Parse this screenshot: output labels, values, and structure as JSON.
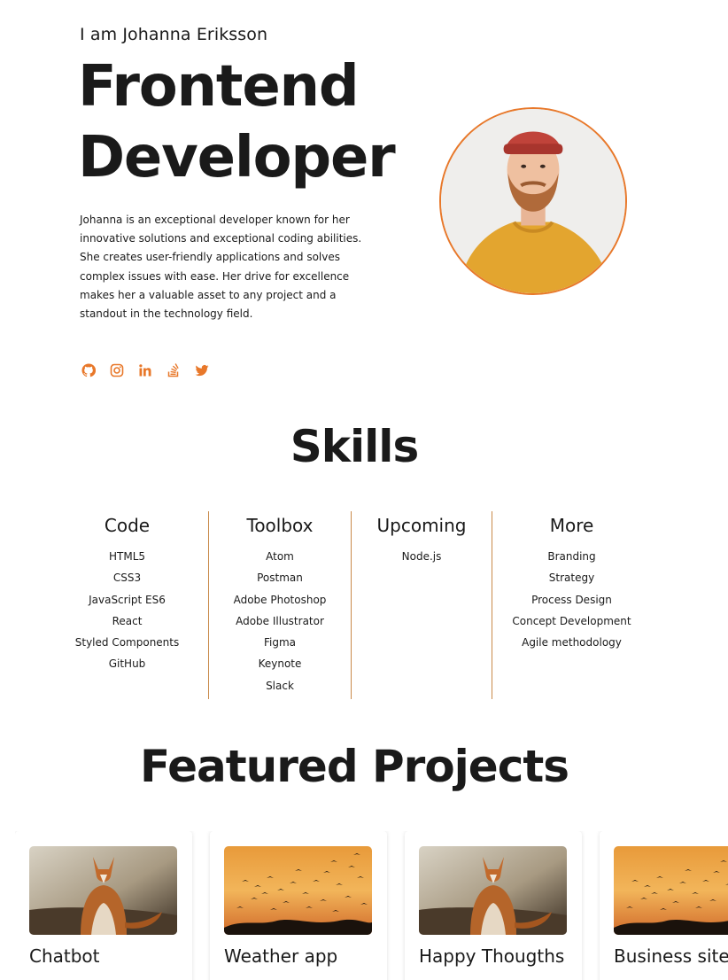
{
  "hero": {
    "intro": "I am Johanna Eriksson",
    "title_line1": "Frontend",
    "title_line2": "Developer",
    "bio": "Johanna is an exceptional developer known for her innovative solutions and exceptional coding abilities. She creates user-friendly applications and solves complex issues with ease. Her drive for excellence makes her a valuable asset to any project and a standout in the technology field.",
    "accent_color": "#e8782a",
    "socials": [
      {
        "icon": "github-icon"
      },
      {
        "icon": "instagram-icon"
      },
      {
        "icon": "linkedin-icon"
      },
      {
        "icon": "stackoverflow-icon"
      },
      {
        "icon": "twitter-icon"
      }
    ]
  },
  "skills": {
    "title": "Skills",
    "columns": [
      {
        "heading": "Code",
        "items": [
          "HTML5",
          "CSS3",
          "JavaScript ES6",
          "React",
          "Styled Components",
          "GitHub"
        ]
      },
      {
        "heading": "Toolbox",
        "items": [
          "Atom",
          "Postman",
          "Adobe Photoshop",
          "Adobe Illustrator",
          "Figma",
          "Keynote",
          "Slack"
        ]
      },
      {
        "heading": "Upcoming",
        "items": [
          "Node.js"
        ]
      },
      {
        "heading": "More",
        "items": [
          "Branding",
          "Strategy",
          "Process Design",
          "Concept Development",
          "Agile methodology"
        ]
      }
    ]
  },
  "projects": {
    "title": "Featured Projects",
    "cards": [
      {
        "title": "Chatbot",
        "image": "fox-image"
      },
      {
        "title": "Weather app",
        "image": "birds-sunset-image"
      },
      {
        "title": "Happy Thougths",
        "image": "fox-image"
      },
      {
        "title": "Business site",
        "image": "birds-sunset-image"
      }
    ]
  }
}
